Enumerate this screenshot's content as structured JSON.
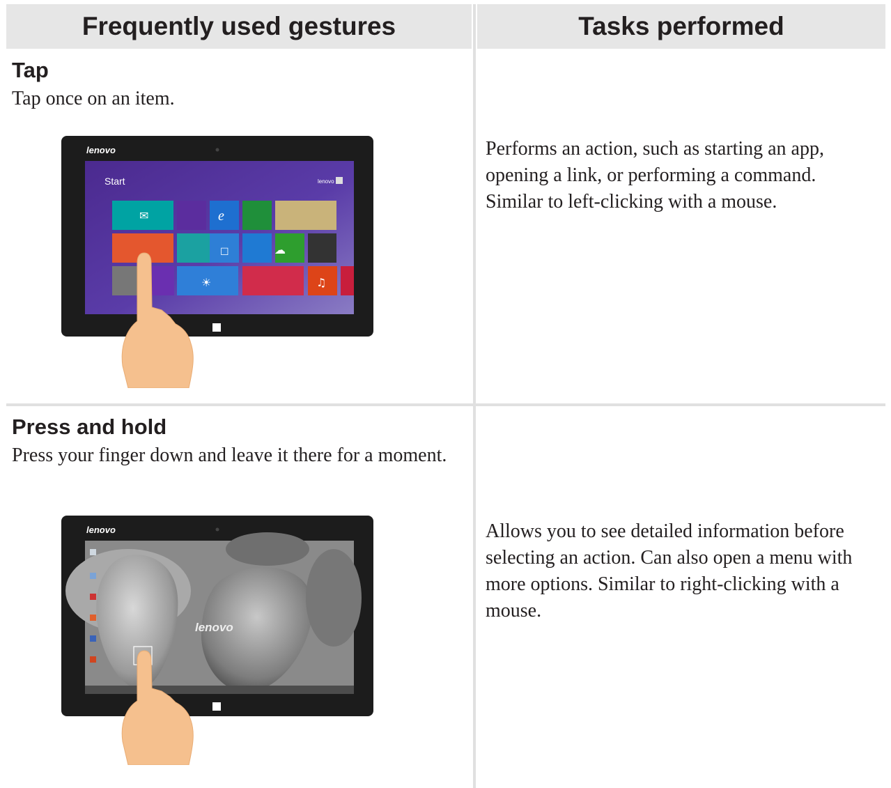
{
  "table": {
    "headers": [
      "Frequently used gestures",
      "Tasks performed"
    ],
    "rows": [
      {
        "gesture": "Tap",
        "instruction": "Tap once on an item.",
        "task": "Performs an action, such as starting an app, opening a link, or performing a command. Similar to left-clicking with a mouse.",
        "illustration": {
          "brand": "lenovo",
          "screen_title": "Start",
          "user": "lenovo",
          "tile_colors": [
            "#00a3a3",
            "#5b2d9e",
            "#1e6fd0",
            "#1f8f3a",
            "#c9b37a",
            "#e4572e",
            "#1ba1a1",
            "#2e7fd6",
            "#1f7ad3",
            "#2e9e2e",
            "#333333",
            "#6a2fb0",
            "#2f7fd8",
            "#d12c4b",
            "#dd4418",
            "#c81e3c"
          ],
          "icons": [
            "mail-icon",
            "calendar-icon",
            "ie-icon",
            "store-icon",
            "people-icon",
            "photos-icon",
            "maps-icon",
            "skydrive-icon",
            "games-icon",
            "messaging-icon",
            "weather-icon",
            "news-icon",
            "music-icon",
            "windows-icon"
          ]
        }
      },
      {
        "gesture": "Press and hold",
        "instruction": "Press your finger down and leave it there for a moment.",
        "task": "Allows you to see detailed information before selecting an action. Can also open a menu with more options. Similar to right-clicking with a mouse.",
        "illustration": {
          "brand": "lenovo",
          "wallpaper_logo": "lenovo",
          "icons": [
            "desktop-icons",
            "windows-icon"
          ]
        }
      }
    ]
  },
  "colors": {
    "header_bg": "#e6e6e6",
    "rule": "#e0e0e0",
    "skin": "#f5c08e",
    "text": "#231f20"
  }
}
